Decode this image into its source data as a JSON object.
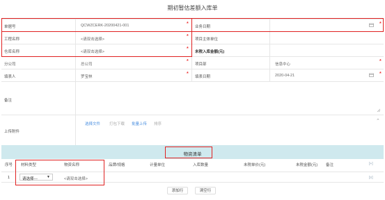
{
  "page_title": "期初暂估差额入库单",
  "form": {
    "doc_no_label": "单据号",
    "doc_no_value": "QCWZCERK-20200421-001",
    "business_date_label": "业务日期",
    "project_name_label": "工程名称",
    "project_name_placeholder": "<请双击选择>",
    "project_owner_label": "项目主体单位",
    "warehouse_label": "仓库名称",
    "warehouse_placeholder": "<请双击选择>",
    "untaxed_total_label": "未税入库金额(元)",
    "branch_label": "分公司",
    "branch_value": "总公司",
    "project_dept_label": "项目部",
    "project_dept_value": "信息中心",
    "creator_label": "填表人",
    "creator_value": "罗宝林",
    "fill_date_label": "填表日期",
    "fill_date_value": "2020-04-21",
    "remark_label": "备注",
    "attachment_label": "上传附件",
    "attach_actions": [
      "选择文件",
      "打包下载",
      "批量上传",
      "排序"
    ],
    "required_mark": "*"
  },
  "materials": {
    "section_title": "物资清单",
    "columns": [
      "序号",
      "材料类型",
      "物资名称",
      "品牌/规格",
      "计量单位",
      "入库数量",
      "未税单价(元)",
      "未税金额(元)",
      "备注"
    ],
    "add_col_btn": "[+]",
    "row": {
      "index": "1",
      "type_select": "请选择---",
      "name_placeholder": "<请双击选择>",
      "menu_btn": "[≡]"
    },
    "add_row_btn": "添加行",
    "clear_row_btn": "清空行"
  },
  "colors": {
    "required": "#e33333",
    "highlight_box": "#e02020",
    "section_bg": "#cfe9ee",
    "link": "#4a8fe0"
  }
}
